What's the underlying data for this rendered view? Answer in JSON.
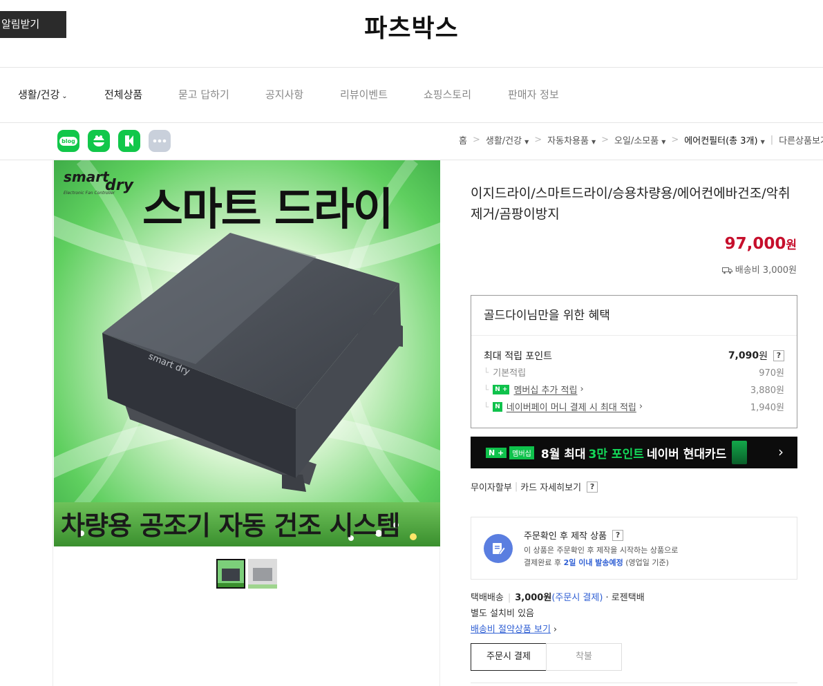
{
  "header": {
    "notify_label": "알림받기",
    "store_name": "파츠박스"
  },
  "nav": {
    "items": [
      {
        "label": "생활/건강"
      },
      {
        "label": "전체상품"
      },
      {
        "label": "묻고 답하기"
      },
      {
        "label": "공지사항"
      },
      {
        "label": "리뷰이벤트"
      },
      {
        "label": "쇼핑스토리"
      },
      {
        "label": "판매자 정보"
      }
    ]
  },
  "share": {
    "blog_label": "blog",
    "icons": [
      "blog-icon",
      "cafe-icon",
      "band-icon",
      "more-icon"
    ]
  },
  "breadcrumb": {
    "home": "홈",
    "level1": "생활/건강",
    "level2": "자동차용품",
    "level3": "오일/소모품",
    "current": "에어컨필터(총 3개)",
    "other": "다른상품보기"
  },
  "product_image": {
    "logo_line1": "smart",
    "logo_line2": "dry",
    "logo_sub": "Electronic Fan Controller",
    "headline": "스마트 드라이",
    "device_text": "smart dry",
    "caption": "차량용 공조기 자동 건조 시스템"
  },
  "product": {
    "title": "이지드라이/스마트드라이/승용차량용/에어컨에바건조/악취제거/곰팡이방지",
    "price_value": "97,000",
    "price_unit": "원",
    "shipping_fee": "배송비 3,000원"
  },
  "benefit": {
    "title": "골드다이님만을 위한 혜택",
    "max_label": "최대 적립 포인트",
    "max_value": "7,090",
    "max_unit": "원",
    "help": "?",
    "basic_label": "기본적립",
    "basic_value": "970원",
    "membership_badge": "N +",
    "membership_label": "멤버십 추가 적립",
    "membership_value": "3,880원",
    "npay_badge": "N",
    "npay_label": "네이버페이 머니 결제 시 최대 적립",
    "npay_value": "1,940원"
  },
  "banner": {
    "n_badge": "N +",
    "m_badge": "멤버십",
    "text1": "8월 최대",
    "highlight": "3만 포인트",
    "text2": "네이버 현대카드"
  },
  "installment": {
    "label1": "무이자할부",
    "label2": "카드 자세히보기",
    "help": "?"
  },
  "order_notice": {
    "title": "주문확인 후 제작 상품",
    "help": "?",
    "line1": "이 상품은 주문확인 후 제작을 시작하는 상품으로",
    "line2_prefix": "결제완료 후",
    "line2_highlight": "2일 이내 발송예정",
    "line2_suffix": "(영업일 기준)"
  },
  "shipping": {
    "method": "택배배송",
    "fee": "3,000원",
    "fee_note": "(주문시 결제)",
    "courier": "· 로젠택배",
    "install_note": "별도 설치비 있음",
    "saving_link": "배송비 절약상품 보기"
  },
  "payment_tabs": {
    "active": "주문시 결제",
    "inactive": "착불"
  },
  "colors": {
    "price": "#c60f2c",
    "naver_green": "#11c74a",
    "link_blue": "#2f5fd4"
  }
}
